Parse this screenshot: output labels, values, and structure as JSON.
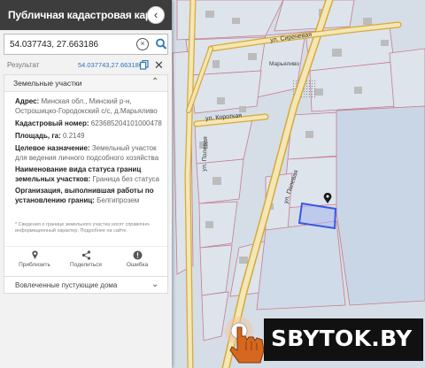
{
  "header": {
    "title": "Публичная кадастровая карта",
    "collapse_icon": "chevron-left-icon"
  },
  "search": {
    "value": "54.037743, 27.663186",
    "clear_icon": "clear-circle-icon",
    "search_icon": "search-icon"
  },
  "result": {
    "label": "Результат",
    "coords": "54.037743,27.663186"
  },
  "section": {
    "title": "Земельные участки",
    "fields": [
      {
        "label": "Адрес:",
        "value": "Минская обл., Минский р-н, Острошицко-Городокский с/с, д.Марьяливо"
      },
      {
        "label": "Кадастровый номер:",
        "value": "623685204101000478"
      },
      {
        "label": "Площадь, га:",
        "value": "0.2149"
      },
      {
        "label": "Целевое назначение:",
        "value": "Земельный участок для ведения личного подсобного хозяйства"
      },
      {
        "label": "Наименование вида статуса границ земельных участков:",
        "value": "Граница без статуса"
      },
      {
        "label": "Организация, выполнившая работы по установлению границ:",
        "value": "Белгипрозем"
      }
    ],
    "note": "* Сведения о границе земельного участка носят справочно-информационный характер. Подробнее на сайте."
  },
  "actions": [
    {
      "label": "Приблизить",
      "icon": "location-pin-icon"
    },
    {
      "label": "Поделиться",
      "icon": "share-icon"
    },
    {
      "label": "Ошибка",
      "icon": "error-icon"
    }
  ],
  "collapsed_section": {
    "title": "Вовлеченные пустующие дома"
  },
  "map": {
    "streets": [
      "ул. Сиреневая",
      "ул. Короткая",
      "ул. Полевая",
      "ул. Полевая"
    ],
    "village_label": "Марьяливо",
    "accent": "#e52a2a",
    "parcel_color": "#3d55e6"
  },
  "watermark": {
    "text": "SBYTOK.BY"
  }
}
